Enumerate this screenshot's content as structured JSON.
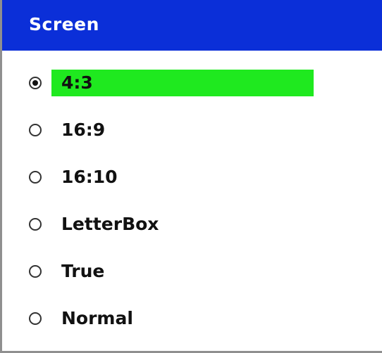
{
  "menu": {
    "title": "Screen",
    "colors": {
      "title_background": "#0b2fd8",
      "title_text": "#ffffff",
      "selected_highlight": "#1fe91f",
      "border": "#8f8f8f"
    },
    "options": [
      {
        "label": "4:3",
        "selected": true
      },
      {
        "label": "16:9",
        "selected": false
      },
      {
        "label": "16:10",
        "selected": false
      },
      {
        "label": "LetterBox",
        "selected": false
      },
      {
        "label": "True",
        "selected": false
      },
      {
        "label": "Normal",
        "selected": false
      }
    ]
  }
}
